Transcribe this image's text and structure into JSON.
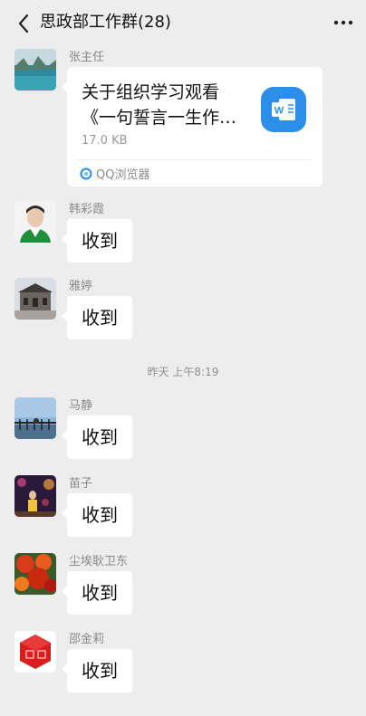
{
  "header": {
    "title": "思政部工作群(28)",
    "back_icon": "chevron-left-icon",
    "more_label": "•••"
  },
  "colors": {
    "background": "#ededed",
    "bubble": "#ffffff",
    "word_icon": "#2b8fe9"
  },
  "messages": [
    {
      "sender": "张主任",
      "type": "file",
      "file": {
        "title_line1": "关于组织学习观看",
        "title_line2": "《一句誓言一生作…",
        "size": "17.0 KB",
        "source": "QQ浏览器",
        "icon": "word-doc-icon"
      }
    },
    {
      "sender": "韩彩霞",
      "type": "text",
      "text": "收到"
    },
    {
      "sender": "雅婷",
      "type": "text",
      "text": "收到"
    },
    {
      "sender": "马静",
      "type": "text",
      "text": "收到"
    },
    {
      "sender": "苗子",
      "type": "text",
      "text": "收到"
    },
    {
      "sender": "尘埃耿卫东",
      "type": "text",
      "text": "收到"
    },
    {
      "sender": "邵金莉",
      "type": "text",
      "text": "收到"
    }
  ],
  "timestamp": "昨天 上午8:19"
}
